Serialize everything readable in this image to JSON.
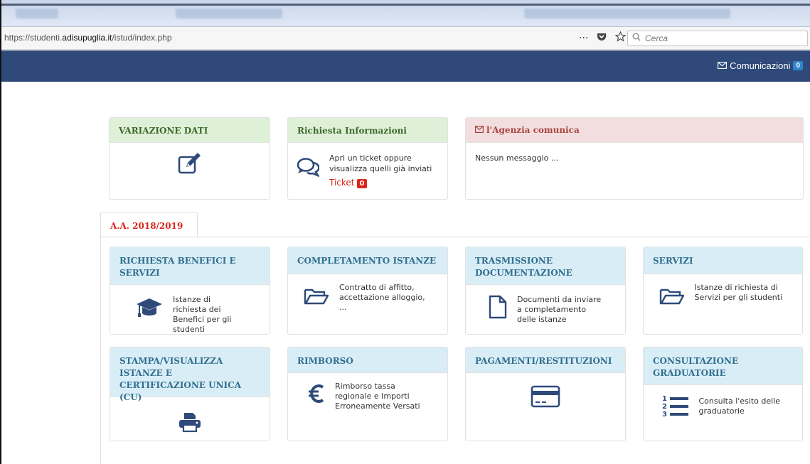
{
  "browser": {
    "url_prefix": "https://studenti.",
    "url_domain": "adisupuglia.it",
    "url_path": "/istud/index.php",
    "search_placeholder": "Cerca",
    "more_glyph": "···"
  },
  "navbar": {
    "communications_label": "Comunicazioni",
    "communications_count": "0"
  },
  "top_panels": {
    "variazione": {
      "title": "VARIAZIONE DATI",
      "icon": "edit-icon"
    },
    "info": {
      "title": "Richiesta Informazioni",
      "text": "Apri un ticket oppure visualizza quelli già inviati",
      "ticket_label": "Ticket",
      "ticket_count": "0",
      "icon": "chat-icon"
    },
    "agency": {
      "title": "l'Agenzia comunica",
      "text": "Nessun messaggio ...",
      "icon": "envelope-icon"
    }
  },
  "tab": {
    "label": "A.A. 2018/2019"
  },
  "cards": [
    {
      "title": "RICHIESTA BENEFICI E SERVIZI",
      "text": "Istanze di richiesta dei Benefici per gli studenti",
      "icon": "graduation-cap-icon"
    },
    {
      "title": "COMPLETAMENTO ISTANZE",
      "text": "Contratto di affitto, accettazione alloggio, ...",
      "icon": "folder-icon"
    },
    {
      "title": "TRASMISSIONE DOCUMENTAZIONE",
      "text": "Documenti da inviare a completamento delle istanze",
      "icon": "document-icon"
    },
    {
      "title": "SERVIZI",
      "text": "Istanze di richiesta di Servizi per gli studenti",
      "icon": "folder-icon"
    },
    {
      "title": "STAMPA/VISUALIZZA ISTANZE E CERTIFICAZIONE UNICA (CU)",
      "text": "",
      "icon": "printer-icon"
    },
    {
      "title": "RIMBORSO",
      "text": "Rimborso tassa regionale e Importi Erroneamente Versati",
      "icon": "euro-icon"
    },
    {
      "title": "PAGAMENTI/RESTITUZIONI",
      "text": "",
      "icon": "credit-card-icon"
    },
    {
      "title": "CONSULTAZIONE GRADUATORIE",
      "text": "Consulta l'esito delle graduatorie",
      "icon": "ordered-list-icon"
    }
  ],
  "colors": {
    "navbar": "#2f4a7a",
    "icon": "#2f4a7a",
    "ticket_red": "#d9261c",
    "badge_blue": "#2e86c9"
  }
}
